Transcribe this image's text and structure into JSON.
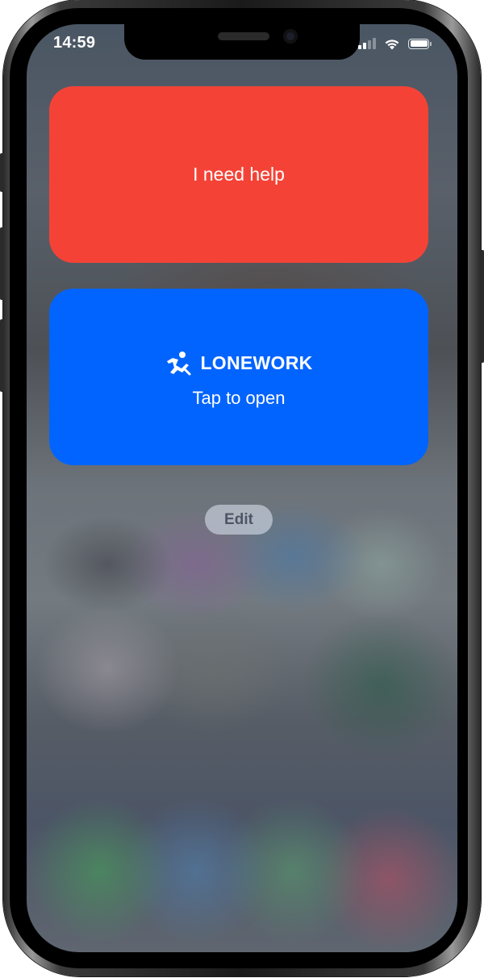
{
  "status_bar": {
    "time": "14:59",
    "signal_icon": "cellular-signal-icon",
    "wifi_icon": "wifi-icon",
    "battery_icon": "battery-icon",
    "battery_level": 1.0
  },
  "widgets": {
    "help": {
      "label": "I need help",
      "color": "#f44336"
    },
    "lonework": {
      "icon": "falling-person-icon",
      "app_name": "LONEWORK",
      "subtitle": "Tap to open",
      "color": "#0264fe"
    }
  },
  "edit_button": {
    "label": "Edit"
  }
}
